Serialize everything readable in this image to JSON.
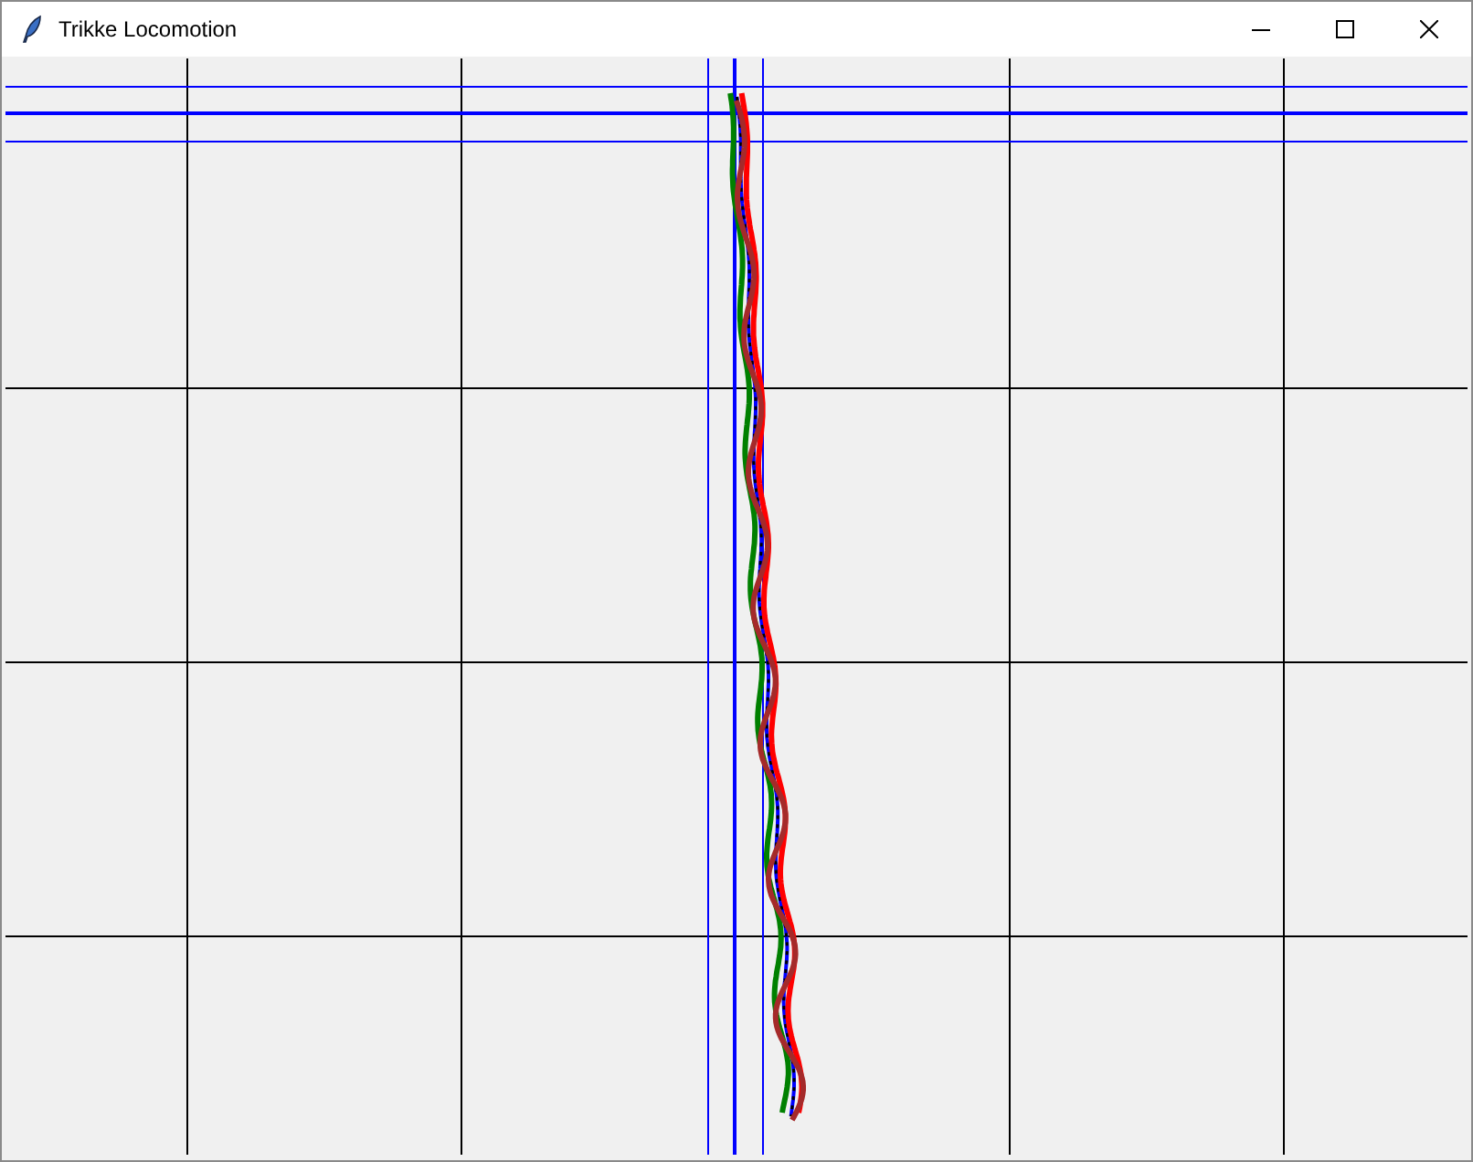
{
  "window": {
    "title": "Trikke Locomotion"
  }
}
